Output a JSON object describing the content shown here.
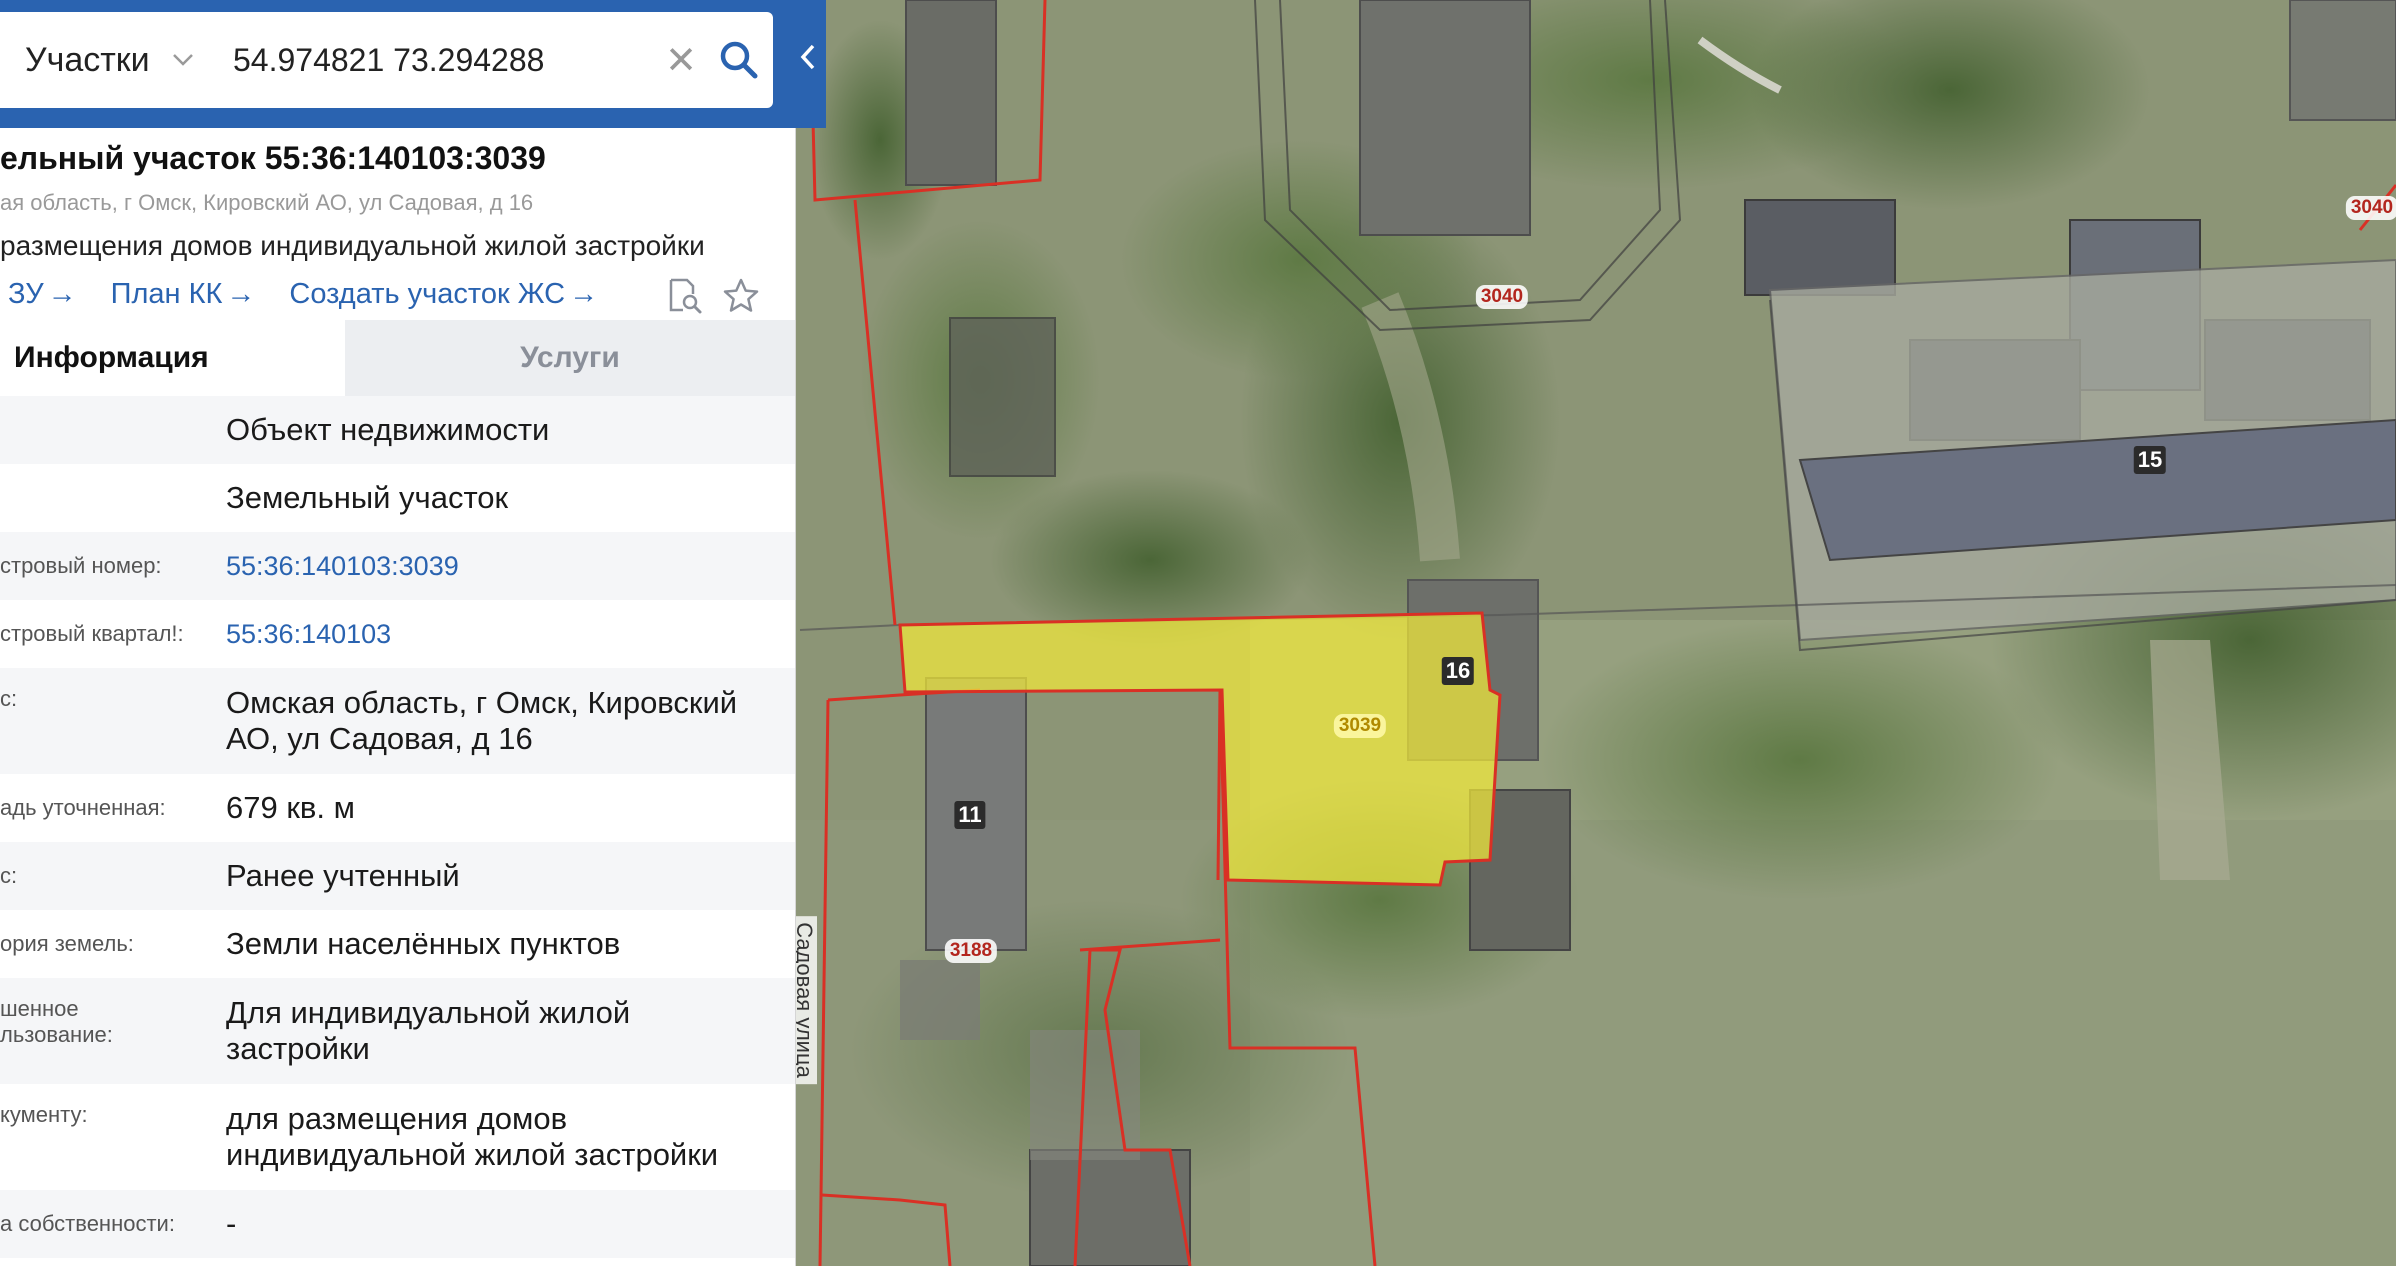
{
  "search": {
    "layer": "Участки",
    "query": "54.974821 73.294288",
    "clear_symbol": "✕"
  },
  "parcel": {
    "title": "ельный участок 55:36:140103:3039",
    "address": "ая область, г Омск, Кировский АО, ул Садовая, д 16",
    "purpose": "размещения домов индивидуальной жилой застройки"
  },
  "actions": [
    {
      "label": "ЗУ",
      "arrow": "→"
    },
    {
      "label": "План КК",
      "arrow": "→"
    },
    {
      "label": "Создать участок ЖС",
      "arrow": "→"
    }
  ],
  "icons": {
    "search": "search-icon",
    "collapse": "chevron-left-icon",
    "layer_dropdown": "chevron-down-icon",
    "document_search": "document-search-icon",
    "favorite": "star-icon"
  },
  "tabs": {
    "info": "Информация",
    "services": "Услуги"
  },
  "info_rows": [
    {
      "key": "",
      "value": "Объект недвижимости"
    },
    {
      "key": "",
      "value": "Земельный участок"
    },
    {
      "key": "стровый номер:",
      "value": "55:36:140103:3039",
      "link": true
    },
    {
      "key": "стровый квартал!:",
      "value": "55:36:140103",
      "link": true
    },
    {
      "key": "с:",
      "value": "Омская область, г Омск, Кировский АО, ул Садовая, д 16"
    },
    {
      "key": "адь уточненная:",
      "value": "679 кв. м"
    },
    {
      "key": "с:",
      "value": "Ранее учтенный"
    },
    {
      "key": "ория земель:",
      "value": "Земли населённых пунктов"
    },
    {
      "key": "шенное\nльзование:",
      "value": "Для индивидуальной жилой застройки"
    },
    {
      "key": "кументу:",
      "value": "для размещения домов индивидуальной жилой застройки"
    },
    {
      "key": "а собственности:",
      "value": "-"
    }
  ],
  "map_labels": {
    "parcels": [
      "3040",
      "3040",
      "3039",
      "3188"
    ],
    "houses": [
      "16",
      "11",
      "15"
    ],
    "street": "Садовая улица"
  },
  "colors": {
    "accent": "#2a63b0",
    "parcel_border": "#d93025",
    "selected_fill": "#f2ea3a",
    "link": "#2a63b0"
  }
}
